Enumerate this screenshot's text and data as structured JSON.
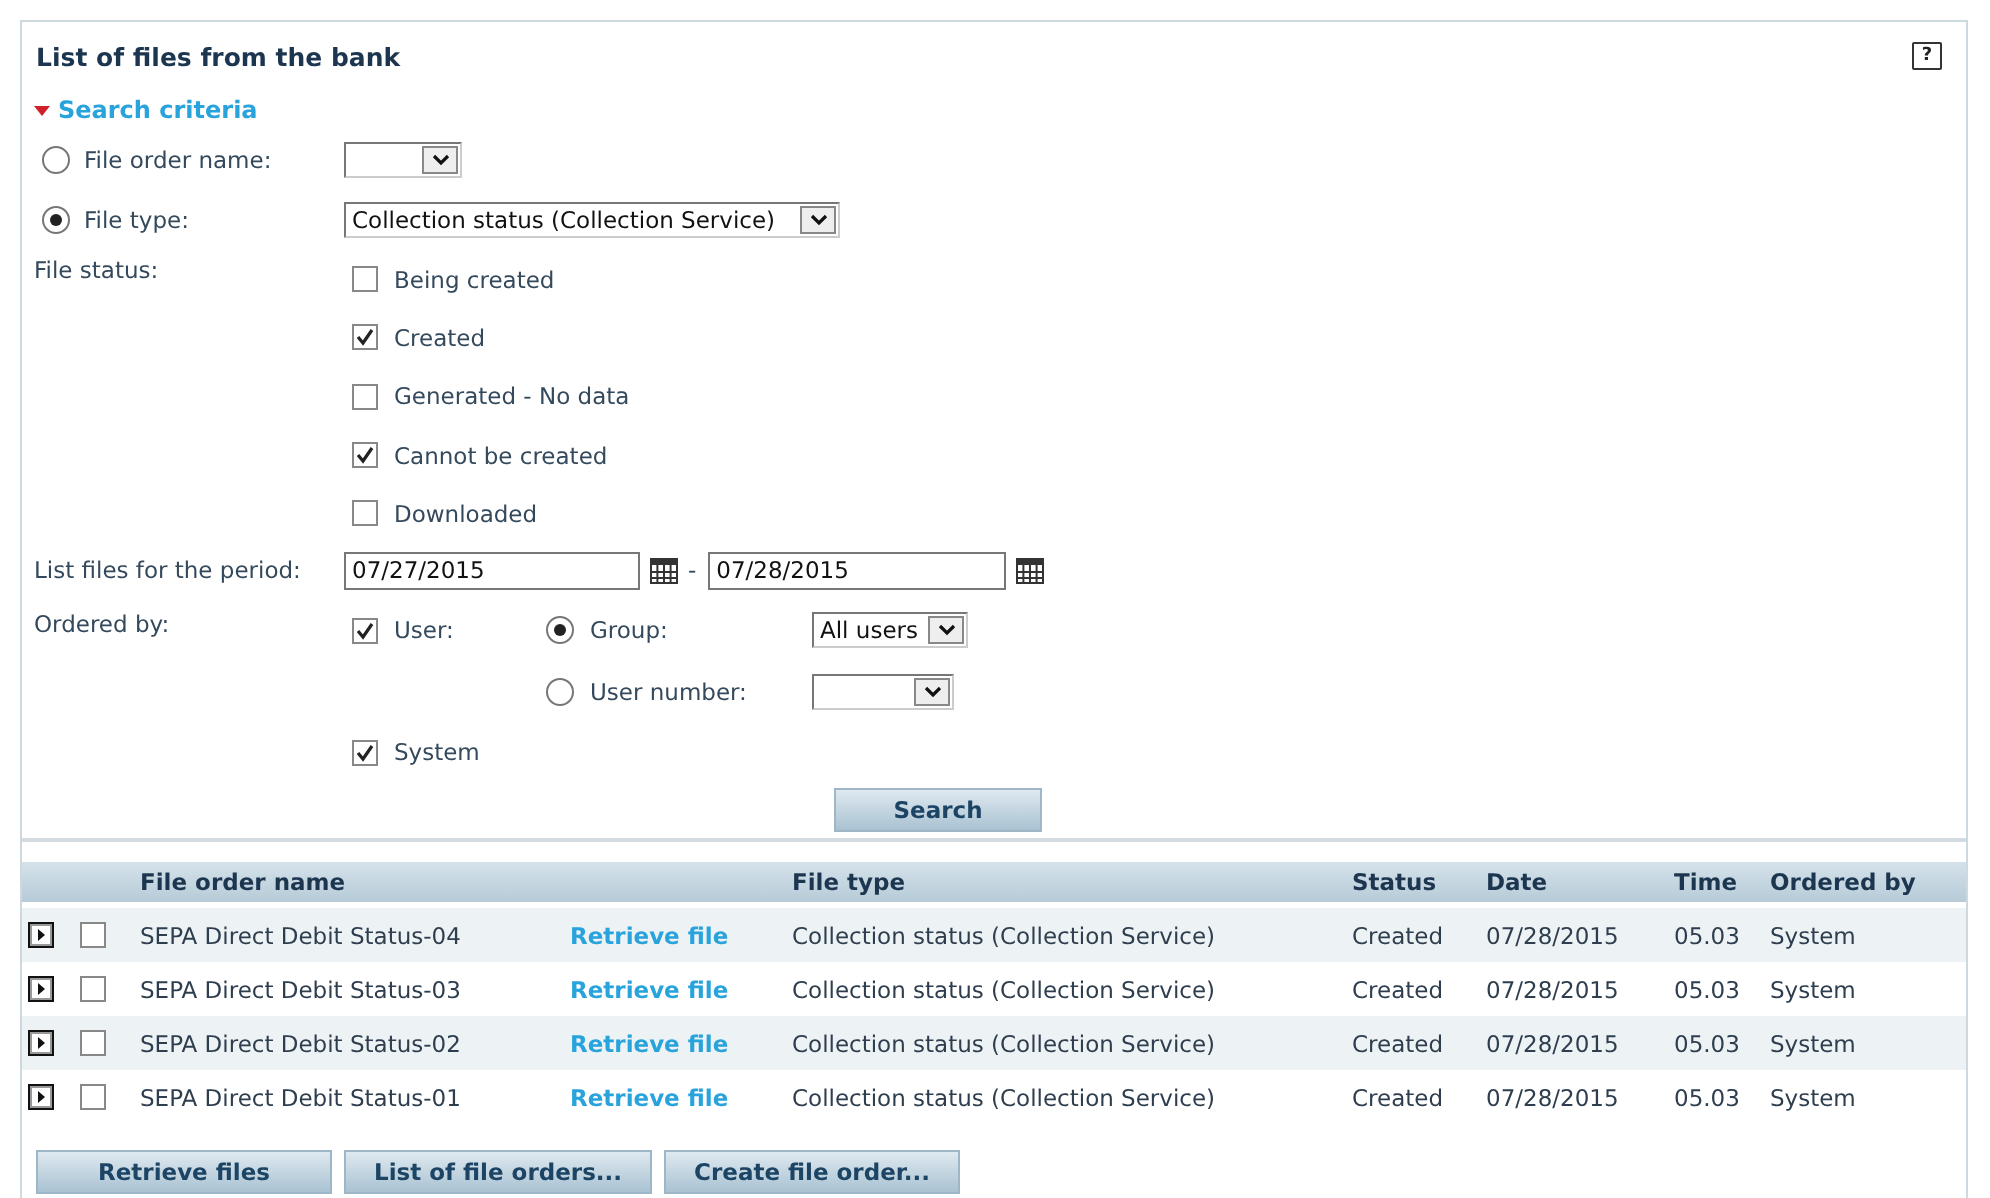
{
  "title": "List of files from the bank",
  "help": "?",
  "search_criteria": {
    "label": "Search criteria",
    "expanded": true
  },
  "file_order_name": {
    "label": "File order name:",
    "selected": false
  },
  "file_type": {
    "label": "File type:",
    "selected": true,
    "value": "Collection status (Collection Service)"
  },
  "file_status": {
    "label": "File status:",
    "options": [
      {
        "label": "Being created",
        "checked": false
      },
      {
        "label": "Created",
        "checked": true
      },
      {
        "label": "Generated - No data",
        "checked": false
      },
      {
        "label": "Cannot be created",
        "checked": true
      },
      {
        "label": "Downloaded",
        "checked": false
      }
    ]
  },
  "period": {
    "label": "List files for the period:",
    "from": "07/27/2015",
    "separator": "-",
    "to": "07/28/2015"
  },
  "ordered_by": {
    "label": "Ordered by:",
    "user": {
      "label": "User:",
      "checked": true
    },
    "group": {
      "label": "Group:",
      "selected": true,
      "value": "All users"
    },
    "user_number": {
      "label": "User number:",
      "selected": false
    },
    "system": {
      "label": "System",
      "checked": true
    }
  },
  "search_button": "Search",
  "table": {
    "columns": [
      "File order name",
      "File type",
      "Status",
      "Date",
      "Time",
      "Ordered by"
    ],
    "rows": [
      {
        "name": "SEPA Direct Debit Status-04",
        "link": "Retrieve file",
        "type": "Collection status (Collection Service)",
        "status": "Created",
        "date": "07/28/2015",
        "time": "05.03",
        "ordered_by": "System",
        "checked": false
      },
      {
        "name": "SEPA Direct Debit Status-03",
        "link": "Retrieve file",
        "type": "Collection status (Collection Service)",
        "status": "Created",
        "date": "07/28/2015",
        "time": "05.03",
        "ordered_by": "System",
        "checked": false
      },
      {
        "name": "SEPA Direct Debit Status-02",
        "link": "Retrieve file",
        "type": "Collection status (Collection Service)",
        "status": "Created",
        "date": "07/28/2015",
        "time": "05.03",
        "ordered_by": "System",
        "checked": false
      },
      {
        "name": "SEPA Direct Debit Status-01",
        "link": "Retrieve file",
        "type": "Collection status (Collection Service)",
        "status": "Created",
        "date": "07/28/2015",
        "time": "05.03",
        "ordered_by": "System",
        "checked": false
      }
    ]
  },
  "buttons": [
    "Retrieve files",
    "List of file orders...",
    "Create file order..."
  ]
}
